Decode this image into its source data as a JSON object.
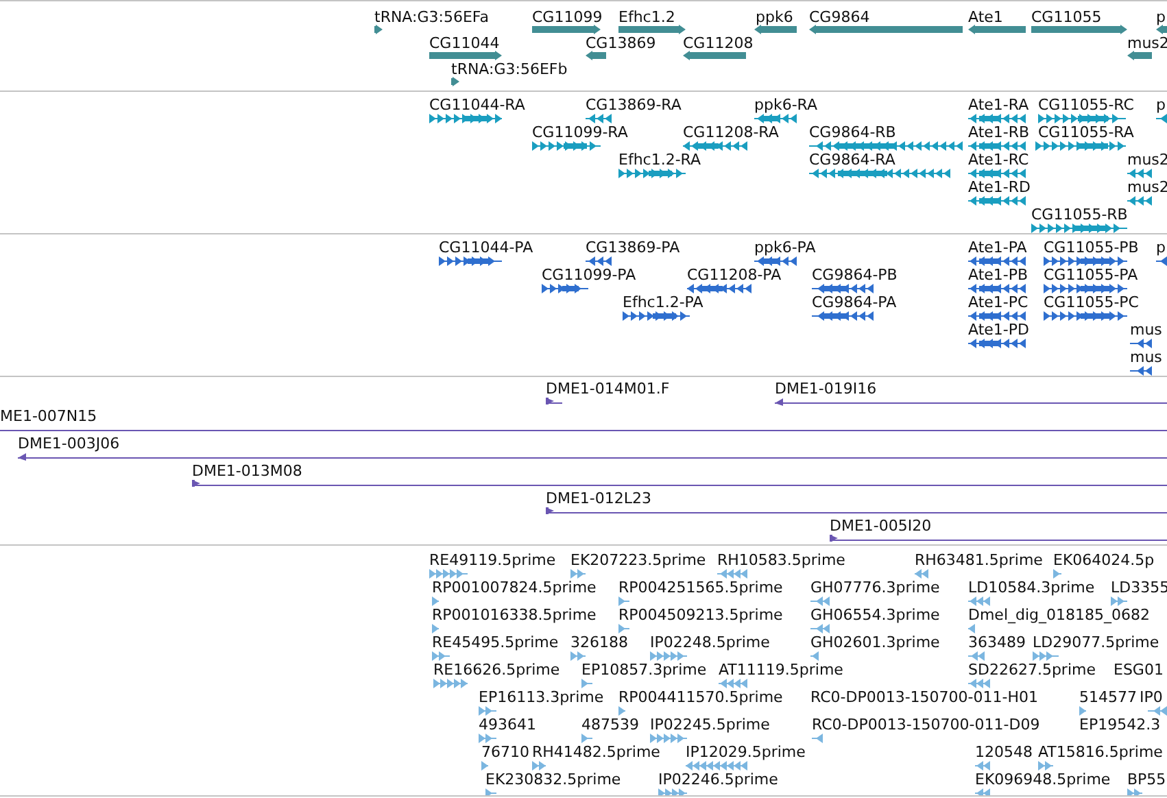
{
  "tracks": [
    {
      "kind": "gene",
      "color": "#428e94",
      "features": [
        {
          "label": "tRNA:G3:56EFa",
          "reverse": false
        },
        {
          "label": "CG11099",
          "reverse": false
        },
        {
          "label": "Efhc1.2",
          "reverse": false
        },
        {
          "label": "ppk6",
          "reverse": true
        },
        {
          "label": "CG9864",
          "reverse": true
        },
        {
          "label": "Ate1",
          "reverse": true
        },
        {
          "label": "CG11055",
          "reverse": false
        },
        {
          "label": "p",
          "reverse": true
        },
        {
          "label": "CG11044",
          "reverse": false
        },
        {
          "label": "CG13869",
          "reverse": true
        },
        {
          "label": "CG11208",
          "reverse": true
        },
        {
          "label": "mus2",
          "reverse": true
        },
        {
          "label": "tRNA:G3:56EFb",
          "reverse": false
        }
      ]
    },
    {
      "kind": "transcript",
      "color": "#1a9ec0",
      "features": [
        {
          "label": "CG11044-RA",
          "reverse": false
        },
        {
          "label": "CG13869-RA",
          "reverse": true
        },
        {
          "label": "ppk6-RA",
          "reverse": true
        },
        {
          "label": "Ate1-RA",
          "reverse": true
        },
        {
          "label": "CG11055-RC",
          "reverse": false
        },
        {
          "label": "p",
          "reverse": true
        },
        {
          "label": "CG11099-RA",
          "reverse": false
        },
        {
          "label": "CG11208-RA",
          "reverse": true
        },
        {
          "label": "CG9864-RB",
          "reverse": true
        },
        {
          "label": "Ate1-RB",
          "reverse": true
        },
        {
          "label": "CG11055-RA",
          "reverse": false
        },
        {
          "label": "Efhc1.2-RA",
          "reverse": false
        },
        {
          "label": "CG9864-RA",
          "reverse": true
        },
        {
          "label": "Ate1-RC",
          "reverse": true
        },
        {
          "label": "mus2",
          "reverse": true
        },
        {
          "label": "Ate1-RD",
          "reverse": true
        },
        {
          "label": "mus2",
          "reverse": true
        },
        {
          "label": "CG11055-RB",
          "reverse": false
        }
      ]
    },
    {
      "kind": "protein",
      "color": "#2f6fcf",
      "features": [
        {
          "label": "CG11044-PA",
          "reverse": false
        },
        {
          "label": "CG13869-PA",
          "reverse": true
        },
        {
          "label": "ppk6-PA",
          "reverse": true
        },
        {
          "label": "Ate1-PA",
          "reverse": true
        },
        {
          "label": "CG11055-PB",
          "reverse": false
        },
        {
          "label": "p",
          "reverse": true
        },
        {
          "label": "CG11099-PA",
          "reverse": false
        },
        {
          "label": "CG11208-PA",
          "reverse": true
        },
        {
          "label": "CG9864-PB",
          "reverse": true
        },
        {
          "label": "Ate1-PB",
          "reverse": true
        },
        {
          "label": "CG11055-PA",
          "reverse": false
        },
        {
          "label": "Efhc1.2-PA",
          "reverse": false
        },
        {
          "label": "CG9864-PA",
          "reverse": true
        },
        {
          "label": "Ate1-PC",
          "reverse": true
        },
        {
          "label": "CG11055-PC",
          "reverse": false
        },
        {
          "label": "Ate1-PD",
          "reverse": true
        },
        {
          "label": "mus",
          "reverse": true
        },
        {
          "label": "mus",
          "reverse": true
        }
      ]
    },
    {
      "kind": "clone",
      "color": "#6a56b2",
      "features": [
        {
          "label": "DME1-014M01.F",
          "reverse": false
        },
        {
          "label": "DME1-019I16",
          "reverse": true
        },
        {
          "label": "ME1-007N15"
        },
        {
          "label": "DME1-003J06",
          "reverse": true
        },
        {
          "label": "DME1-013M08",
          "reverse": false
        },
        {
          "label": "DME1-012L23",
          "reverse": false
        },
        {
          "label": "DME1-005I20",
          "reverse": false
        }
      ]
    },
    {
      "kind": "est",
      "color": "#7bb6e0",
      "features": [
        {
          "label": "RE49119.5prime",
          "reverse": false
        },
        {
          "label": "EK207223.5prime",
          "reverse": false
        },
        {
          "label": "RH10583.5prime",
          "reverse": true
        },
        {
          "label": "RH63481.5prime",
          "reverse": true
        },
        {
          "label": "EK064024.5p",
          "reverse": false
        },
        {
          "label": "RP001007824.5prime",
          "reverse": false
        },
        {
          "label": "RP004251565.5prime",
          "reverse": false
        },
        {
          "label": "GH07776.3prime",
          "reverse": true
        },
        {
          "label": "LD10584.3prime",
          "reverse": true
        },
        {
          "label": "LD3355",
          "reverse": false
        },
        {
          "label": "RP001016338.5prime",
          "reverse": false
        },
        {
          "label": "RP004509213.5prime",
          "reverse": false
        },
        {
          "label": "GH06554.3prime",
          "reverse": true
        },
        {
          "label": "Dmel_dig_018185_0682",
          "reverse": true
        },
        {
          "label": "RE45495.5prime",
          "reverse": false
        },
        {
          "label": "326188",
          "reverse": false
        },
        {
          "label": "IP02248.5prime",
          "reverse": false
        },
        {
          "label": "GH02601.3prime",
          "reverse": true
        },
        {
          "label": "363489",
          "reverse": true
        },
        {
          "label": "LD29077.5prime",
          "reverse": false
        },
        {
          "label": "RE16626.5prime",
          "reverse": false
        },
        {
          "label": "EP10857.3prime",
          "reverse": false
        },
        {
          "label": "AT11119.5prime",
          "reverse": true
        },
        {
          "label": "SD22627.5prime",
          "reverse": true
        },
        {
          "label": "ESG01"
        },
        {
          "label": "EP16113.3prime",
          "reverse": false
        },
        {
          "label": "RP004411570.5prime",
          "reverse": false
        },
        {
          "label": "RC0-DP0013-150700-011-H01"
        },
        {
          "label": "514577",
          "reverse": false
        },
        {
          "label": "IP0",
          "reverse": true
        },
        {
          "label": "493641",
          "reverse": false
        },
        {
          "label": "487539",
          "reverse": false
        },
        {
          "label": "IP02245.5prime",
          "reverse": false
        },
        {
          "label": "RC0-DP0013-150700-011-D09",
          "reverse": true
        },
        {
          "label": "EP19542.3"
        },
        {
          "label": "76710",
          "reverse": false
        },
        {
          "label": "RH41482.5prime",
          "reverse": false
        },
        {
          "label": "IP12029.5prime",
          "reverse": true
        },
        {
          "label": "120548",
          "reverse": true
        },
        {
          "label": "AT15816.5prime",
          "reverse": false
        },
        {
          "label": "EK230832.5prime",
          "reverse": false
        },
        {
          "label": "IP02246.5prime",
          "reverse": false
        },
        {
          "label": "EK096948.5prime",
          "reverse": true
        },
        {
          "label": "BP55",
          "reverse": false
        }
      ]
    }
  ]
}
